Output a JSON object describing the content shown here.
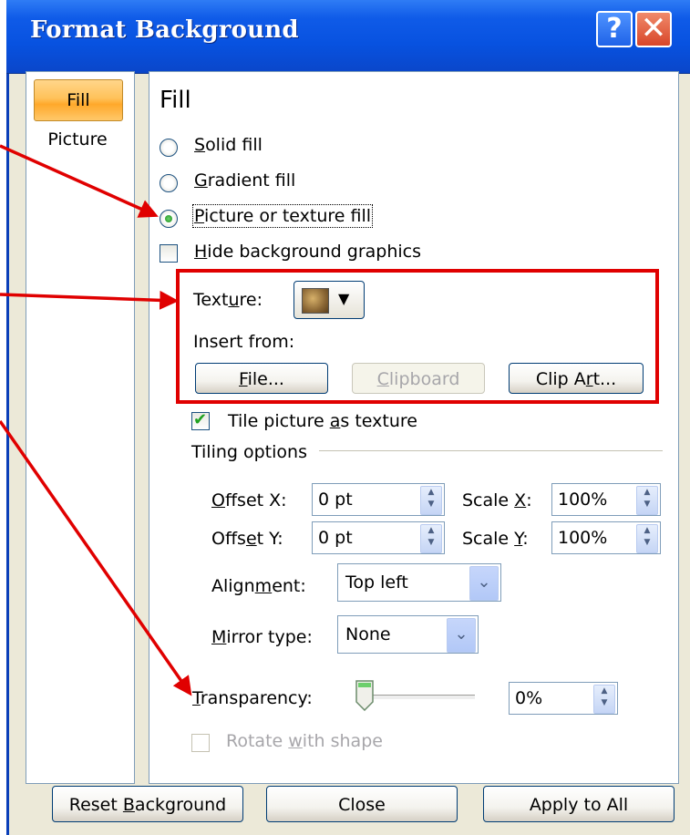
{
  "window": {
    "title": "Format Background",
    "help_glyph": "?",
    "close_glyph": "✕"
  },
  "nav": {
    "items": [
      "Fill",
      "Picture"
    ],
    "selected": "Fill"
  },
  "fill": {
    "heading": "Fill",
    "solid": {
      "pre": "",
      "u": "S",
      "post": "olid fill"
    },
    "gradient": {
      "pre": "",
      "u": "G",
      "post": "radient fill"
    },
    "picture": {
      "pre": "",
      "u": "P",
      "post": "icture or texture fill"
    },
    "hide_bg": {
      "pre": "",
      "u": "H",
      "post": "ide background graphics"
    },
    "selected_option": "Picture or texture fill",
    "hide_bg_checked": false
  },
  "texture": {
    "label": {
      "pre": "Text",
      "u": "u",
      "post": "re:"
    },
    "insert_from_label": "Insert from:",
    "file_btn": {
      "pre": "",
      "u": "F",
      "post": "ile..."
    },
    "clipboard_btn": {
      "pre": "",
      "u": "C",
      "post": "lipboard"
    },
    "clipart_btn": {
      "pre": "Clip A",
      "u": "r",
      "post": "t..."
    }
  },
  "tile": {
    "checkbox": {
      "pre": "Tile picture ",
      "u": "a",
      "post": "s texture"
    },
    "checked": true,
    "options_label": "Tiling options",
    "offset_x": {
      "pre": "",
      "u": "O",
      "post": "ffset X:",
      "value": "0 pt"
    },
    "offset_y": {
      "pre": "Offs",
      "u": "e",
      "post": "t Y:",
      "value": "0 pt"
    },
    "scale_x": {
      "pre": "Scale ",
      "u": "X",
      "post": ":",
      "value": "100%"
    },
    "scale_y": {
      "pre": "Scale ",
      "u": "Y",
      "post": ":",
      "value": "100%"
    },
    "alignment": {
      "pre": "Align",
      "u": "m",
      "post": "ent:",
      "value": "Top left"
    },
    "mirror": {
      "pre": "",
      "u": "M",
      "post": "irror type:",
      "value": "None"
    }
  },
  "transparency": {
    "pre": "",
    "u": "T",
    "post": "ransparency:",
    "value": "0%",
    "level": 0
  },
  "rotate": {
    "pre": "Rotate ",
    "u": "w",
    "post": "ith shape",
    "enabled": false
  },
  "footer": {
    "reset": {
      "pre": "Reset ",
      "u": "B",
      "post": "ackground"
    },
    "close": "Close",
    "apply_all": "Apply to All"
  },
  "colors": {
    "title_blue": "#0852e0",
    "dialog_bg": "#ece9d8",
    "annotation_red": "#e00000",
    "nav_selected": "#ffc25a"
  }
}
